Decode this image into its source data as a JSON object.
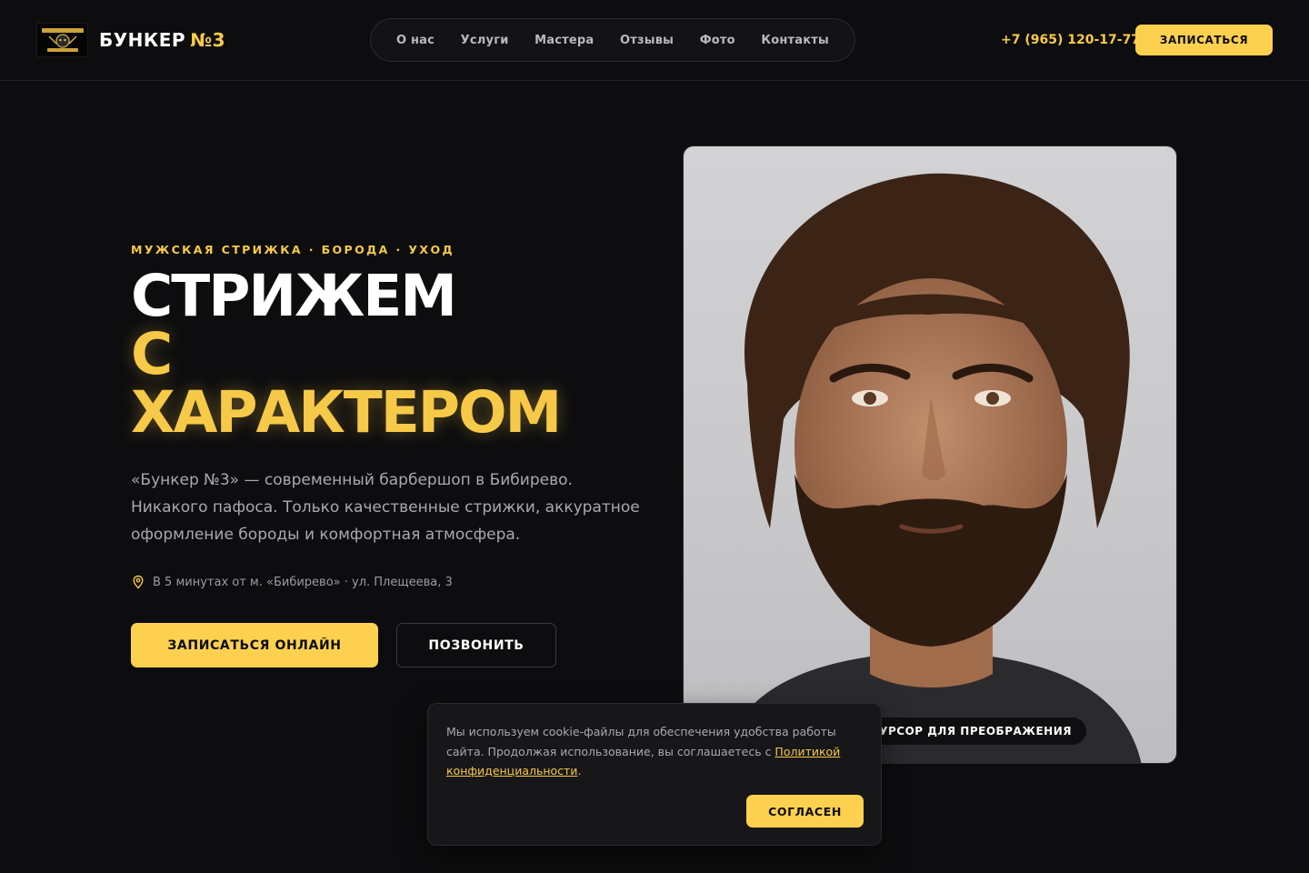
{
  "header": {
    "brand_main": "БУНКЕР",
    "brand_accent": "№3",
    "phone": "+7 (965) 120-17-77",
    "cta_label": "ЗАПИСАТЬСЯ",
    "nav": [
      {
        "label": "О нас"
      },
      {
        "label": "Услуги"
      },
      {
        "label": "Мастера"
      },
      {
        "label": "Отзывы"
      },
      {
        "label": "Фото"
      },
      {
        "label": "Контакты"
      }
    ]
  },
  "hero": {
    "eyebrow": "МУЖСКАЯ СТРИЖКА · БОРОДА · УХОД",
    "title_line1": "СТРИЖЕМ",
    "title_line2": "С",
    "title_line3": "ХАРАКТЕРОМ",
    "description": "«Бункер №3» — современный барбершоп в Бибирево. Никакого пафоса. Только качественные стрижки, аккуратное оформление бороды и комфортная атмосфера.",
    "location": "В 5 минутах от м. «Бибирево» · ул. Плещеева, 3",
    "primary_cta": "ЗАПИСАТЬСЯ ОНЛАЙН",
    "secondary_cta": "ПОЗВОНИТЬ",
    "photo_hint": "НАВЕДИТЕ КУРСОР ДЛЯ ПРЕОБРАЖЕНИЯ"
  },
  "cookie": {
    "text": "Мы используем cookie-файлы для обеспечения удобства работы сайта. Продолжая использование, вы соглашаетесь с ",
    "link": "Политикой конфиденциальности",
    "period": ".",
    "accept": "СОГЛАСЕН"
  },
  "colors": {
    "accent": "#fdd14f",
    "background": "#0d0d0f"
  }
}
